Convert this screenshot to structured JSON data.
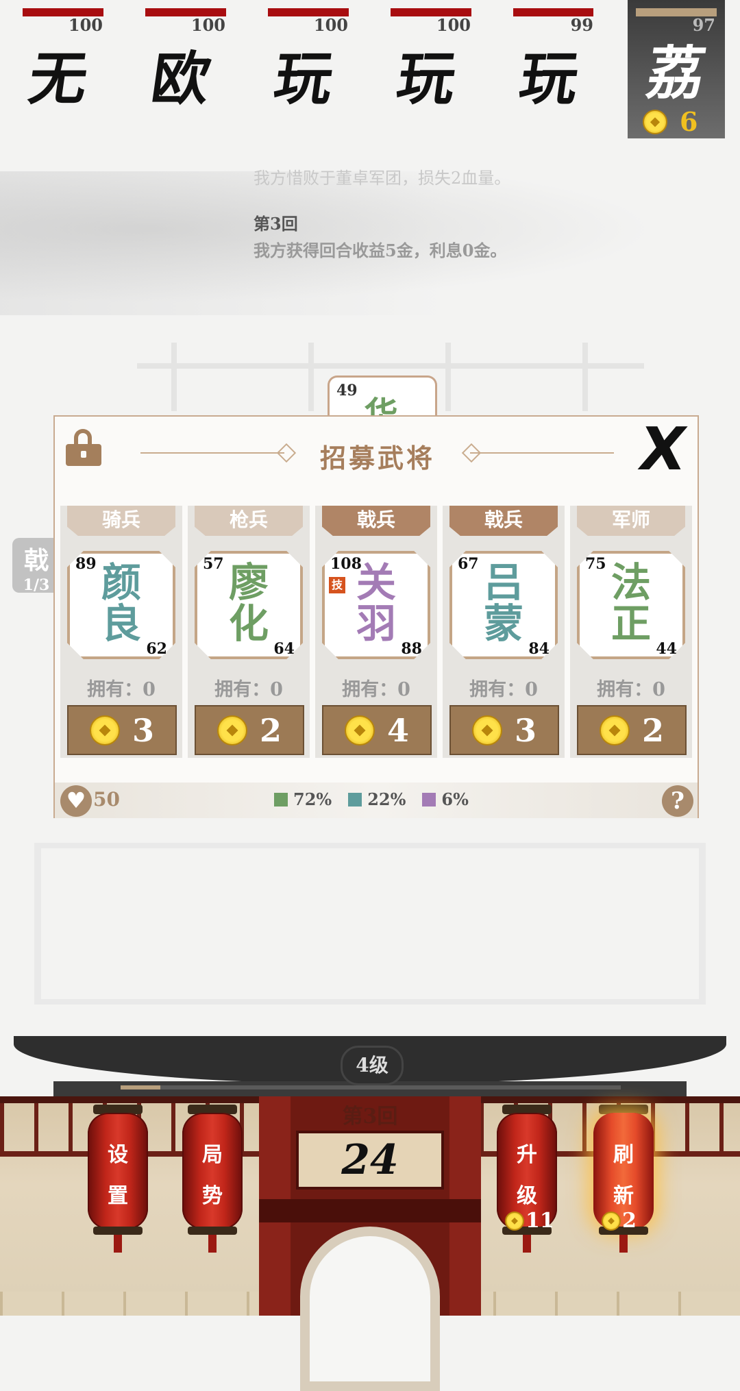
{
  "players": [
    {
      "name": "无",
      "hp": "100",
      "hp_fraction": 1.0
    },
    {
      "name": "欧",
      "hp": "100",
      "hp_fraction": 1.0
    },
    {
      "name": "玩",
      "hp": "100",
      "hp_fraction": 1.0
    },
    {
      "name": "玩",
      "hp": "100",
      "hp_fraction": 1.0
    },
    {
      "name": "玩",
      "hp": "99",
      "hp_fraction": 0.99
    }
  ],
  "self_player": {
    "name": "荔",
    "hp": "97",
    "gold": "6"
  },
  "battle_log": {
    "faded_line": "我方惜败于董卓军团，损失2血量。",
    "round_title": "第3回",
    "round_line": "我方获得回合收益5金，利息0金。"
  },
  "background": {
    "bench_tag": "戟",
    "bench_count": "1/3",
    "board_unit": {
      "stat": "49",
      "name": "华"
    }
  },
  "recruit": {
    "title": "招募武将",
    "close_label": "X",
    "cards": [
      {
        "type": "骑兵",
        "name_top": "颜",
        "name_bottom": "良",
        "stat1": "89",
        "stat2": "62",
        "owned": "拥有：0",
        "cost": "3",
        "type_color": "#d9c9ba",
        "name_color": "#5e9c9c",
        "skill": ""
      },
      {
        "type": "枪兵",
        "name_top": "廖",
        "name_bottom": "化",
        "stat1": "57",
        "stat2": "64",
        "owned": "拥有：0",
        "cost": "2",
        "type_color": "#d9c9ba",
        "name_color": "#6e9e63",
        "skill": ""
      },
      {
        "type": "戟兵",
        "name_top": "关",
        "name_bottom": "羽",
        "stat1": "108",
        "stat2": "88",
        "owned": "拥有：0",
        "cost": "4",
        "type_color": "#b08566",
        "name_color": "#a37bb5",
        "skill": "技"
      },
      {
        "type": "戟兵",
        "name_top": "吕",
        "name_bottom": "蒙",
        "stat1": "67",
        "stat2": "84",
        "owned": "拥有：0",
        "cost": "3",
        "type_color": "#b08566",
        "name_color": "#5e9c9c",
        "skill": ""
      },
      {
        "type": "军师",
        "name_top": "法",
        "name_bottom": "正",
        "stat1": "75",
        "stat2": "44",
        "owned": "拥有：0",
        "cost": "2",
        "type_color": "#d9c9ba",
        "name_color": "#6e9e63",
        "skill": ""
      }
    ],
    "footer": {
      "hearts": "50",
      "odds": [
        {
          "color": "#6e9e63",
          "label": "72%"
        },
        {
          "color": "#5e9c9c",
          "label": "22%"
        },
        {
          "color": "#a37bb5",
          "label": "6%"
        }
      ],
      "help_label": "?"
    }
  },
  "bottom": {
    "level": "4级",
    "xp_fraction": 0.08,
    "round": "第3回",
    "timer": "24",
    "lanterns": [
      {
        "c1": "设",
        "c2": "置",
        "price": ""
      },
      {
        "c1": "局",
        "c2": "势",
        "price": ""
      },
      {
        "c1": "升",
        "c2": "级",
        "price": "11"
      },
      {
        "c1": "刷",
        "c2": "新",
        "price": "2"
      }
    ]
  },
  "colors": {
    "hp_bar": "#a80d10",
    "accent": "#a67e5c",
    "button": "#9c7a55",
    "lantern": "#c1261a"
  }
}
